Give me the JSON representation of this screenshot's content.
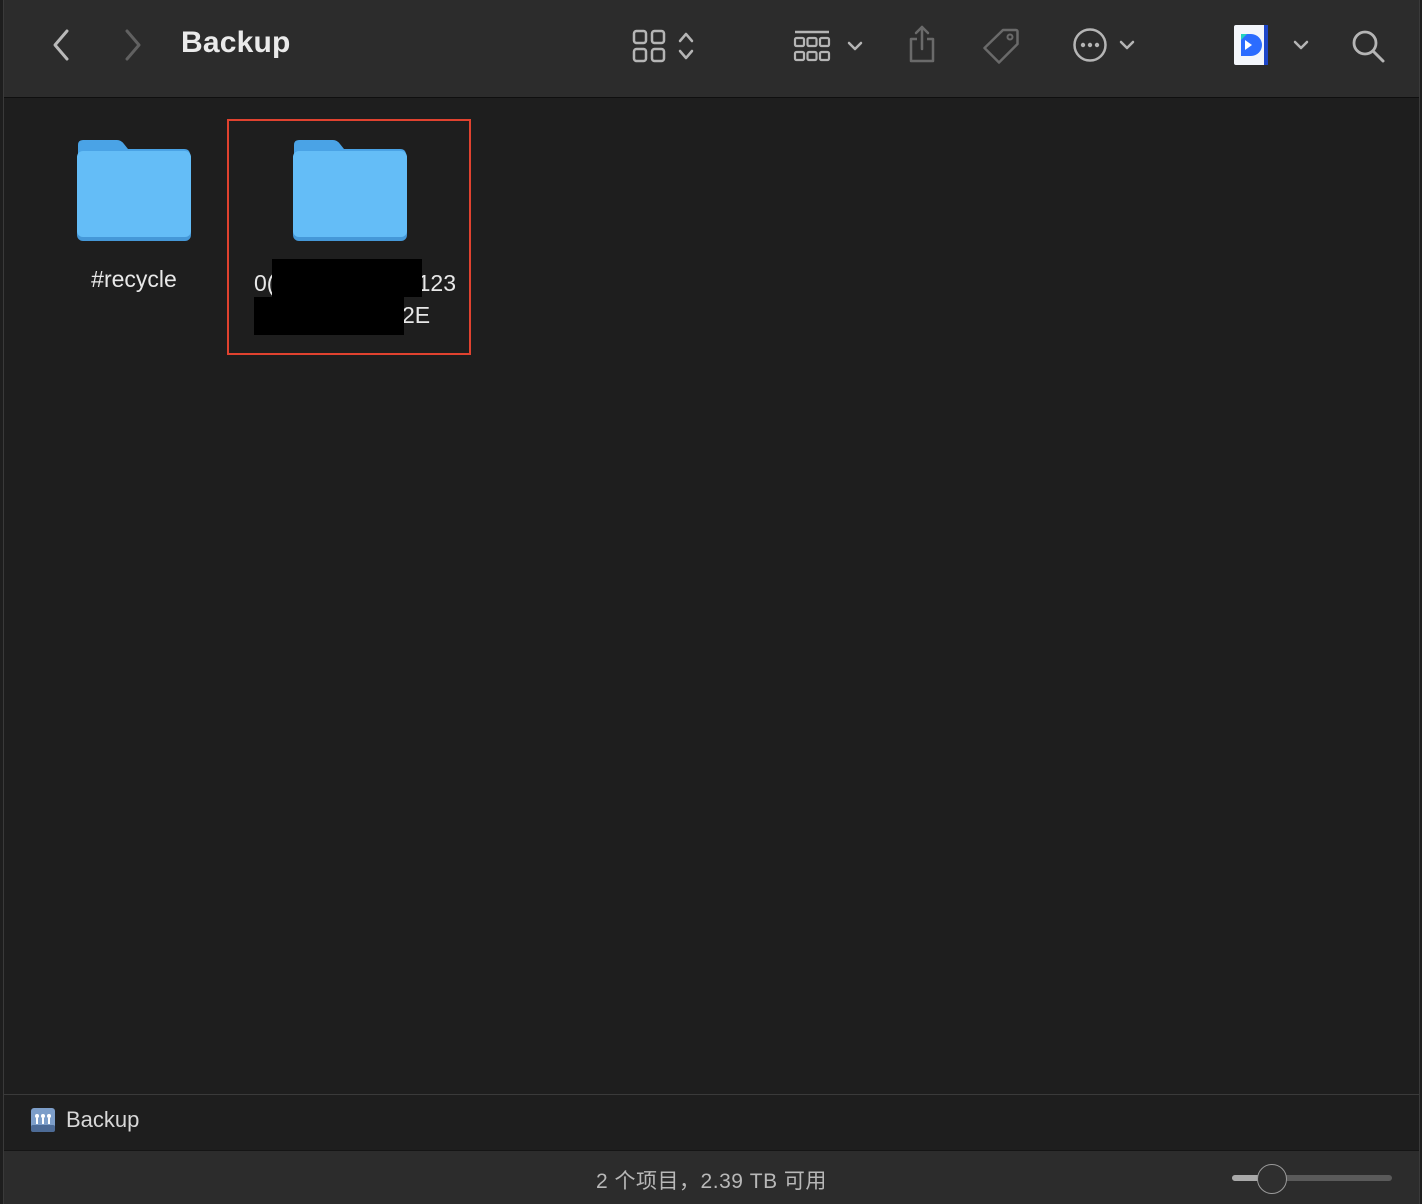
{
  "window": {
    "title": "Backup"
  },
  "toolbar": {
    "back": "chevron-left-icon",
    "forward": "chevron-right-icon",
    "view_mode": "icon-grid-icon",
    "group_by": "group-grid-icon",
    "share": "share-icon",
    "tag": "tag-icon",
    "more": "ellipsis-circle-icon",
    "app": "app-d-icon",
    "search": "search-icon"
  },
  "items": [
    {
      "name": "#recycle",
      "icon": "folder-icon",
      "selected": false
    },
    {
      "name_line1_prefix": "0(",
      "name_line1_suffix": "123",
      "name_line2_suffix": "2E",
      "icon": "folder-icon",
      "selected": true,
      "highlight_color": "#e0422f"
    }
  ],
  "pathbar": {
    "label": "Backup",
    "icon": "network-drive-icon"
  },
  "status": {
    "text": "2 个项目，2.39 TB 可用"
  },
  "zoom_slider": {
    "value": 0.25
  },
  "colors": {
    "accent": "#e0422f",
    "folder": "#5fb8f5"
  }
}
